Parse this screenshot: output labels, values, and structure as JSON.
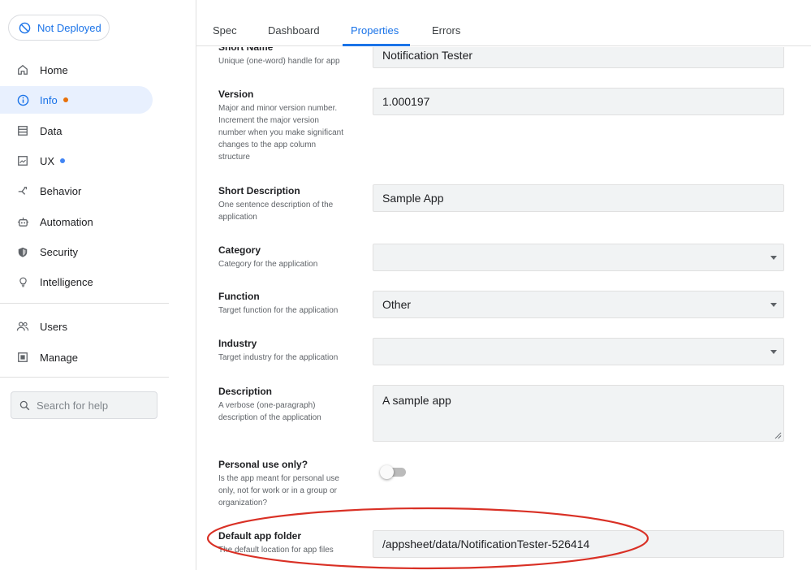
{
  "sidebar": {
    "deploy_status": "Not Deployed",
    "nav": [
      {
        "label": "Home",
        "icon": "home-icon"
      },
      {
        "label": "Info",
        "icon": "info-icon",
        "active": true,
        "dot": "#e8710a"
      },
      {
        "label": "Data",
        "icon": "data-icon"
      },
      {
        "label": "UX",
        "icon": "ux-icon",
        "dot": "#4285f4"
      },
      {
        "label": "Behavior",
        "icon": "behavior-icon"
      },
      {
        "label": "Automation",
        "icon": "robot-icon"
      },
      {
        "label": "Security",
        "icon": "shield-icon"
      },
      {
        "label": "Intelligence",
        "icon": "lightbulb-icon"
      },
      {
        "label": "Users",
        "icon": "users-icon"
      },
      {
        "label": "Manage",
        "icon": "manage-icon"
      }
    ],
    "search_placeholder": "Search for help"
  },
  "tabs": [
    {
      "label": "Spec"
    },
    {
      "label": "Dashboard"
    },
    {
      "label": "Properties",
      "active": true
    },
    {
      "label": "Errors"
    }
  ],
  "properties": {
    "short_name": {
      "title": "Short Name",
      "desc": "Unique (one-word) handle for app",
      "value": "Notification Tester"
    },
    "version": {
      "title": "Version",
      "desc_lines": [
        "Major and minor version number.",
        "Increment the major version",
        "number when you make significant",
        "changes to the app column",
        "structure"
      ],
      "value": "1.000197"
    },
    "short_description": {
      "title": "Short Description",
      "desc_lines": [
        "One sentence description of the",
        "application"
      ],
      "value": "Sample App"
    },
    "category": {
      "title": "Category",
      "desc": "Category for the application",
      "value": ""
    },
    "function": {
      "title": "Function",
      "desc": "Target function for the application",
      "value": "Other"
    },
    "industry": {
      "title": "Industry",
      "desc": "Target industry for the application",
      "value": ""
    },
    "description": {
      "title": "Description",
      "desc_lines": [
        "A verbose (one-paragraph)",
        "description of the application"
      ],
      "value": "A sample app"
    },
    "personal_use": {
      "title": "Personal use only?",
      "desc_lines": [
        "Is the app meant for personal use",
        "only, not for work or in a group or",
        "organization?"
      ],
      "value": "off"
    },
    "default_folder": {
      "title": "Default app folder",
      "desc": "The default location for app files",
      "value": "/appsheet/data/NotificationTester-526414"
    }
  },
  "colors": {
    "accent": "#1a73e8",
    "highlight": "#d93025",
    "active_nav_bg": "#e8f0fe"
  }
}
